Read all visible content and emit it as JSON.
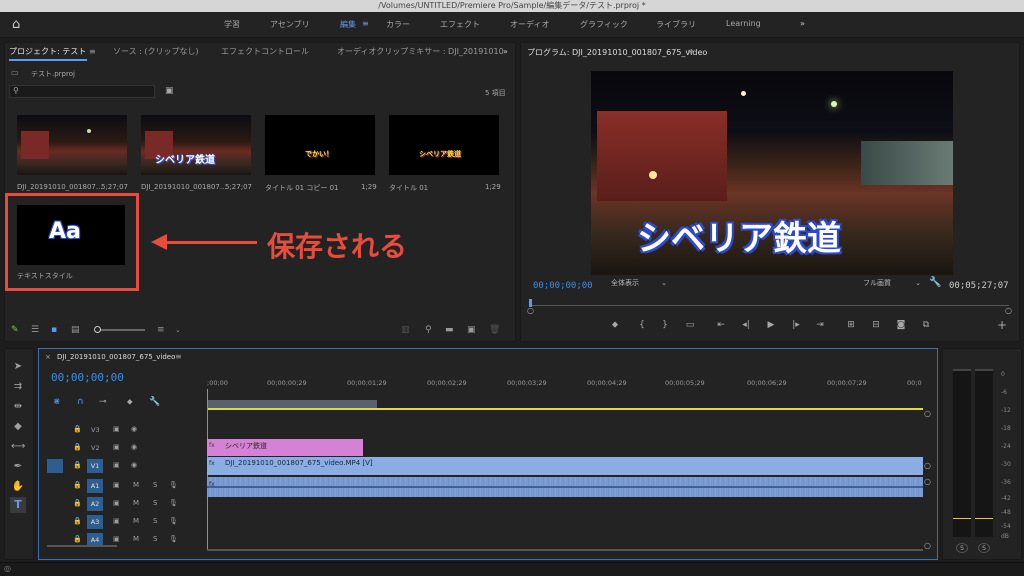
{
  "window": {
    "title": "/Volumes/UNTITLED/Premiere Pro/Sample/編集データ/テスト.prproj *"
  },
  "workspaces": [
    "学習",
    "アセンブリ",
    "編集",
    "カラー",
    "エフェクト",
    "オーディオ",
    "グラフィック",
    "ライブラリ",
    "Learning"
  ],
  "workspace_more": "»",
  "project_panel": {
    "tabs": [
      "プロジェクト: テスト",
      "ソース : (クリップなし)",
      "エフェクトコントロール",
      "オーディオクリップミキサー : DJI_20191010"
    ],
    "more": "»",
    "file": "テスト.prproj",
    "item_count": "5 項目",
    "items": [
      {
        "name": "DJI_20191010_001807...",
        "duration": "5;27;07",
        "overlay": ""
      },
      {
        "name": "DJI_20191010_001807...",
        "duration": "5;27;07",
        "overlay": "シベリア鉄道"
      },
      {
        "name": "タイトル 01 コピー 01",
        "duration": "1;29",
        "overlay": "でかい！"
      },
      {
        "name": "タイトル 01",
        "duration": "1;29",
        "overlay": "シベリア鉄道"
      },
      {
        "name": "テキストスタイル",
        "duration": "",
        "overlay": "Aa"
      }
    ]
  },
  "annotation": {
    "text": "保存される",
    "color": "#e74c3c"
  },
  "program_monitor": {
    "title": "プログラム: DJI_20191010_001807_675_video",
    "overlay_text": "シベリア鉄道",
    "timecode": "00;00;00;00",
    "fit": "全体表示",
    "quality": "フル画質",
    "duration": "00;05;27;07"
  },
  "timeline": {
    "sequence": "DJI_20191010_001807_675_video",
    "timecode": "00;00;00;00",
    "ruler": [
      ";00;00",
      "00;00;00;29",
      "00;00;01;29",
      "00;00;02;29",
      "00;00;03;29",
      "00;00;04;29",
      "00;00;05;29",
      "00;00;06;29",
      "00;00;07;29",
      "00;0"
    ],
    "video_tracks": [
      "V3",
      "V2",
      "V1"
    ],
    "audio_tracks": [
      "A1",
      "A2",
      "A3",
      "A4"
    ],
    "clip_title": "シベリア鉄道",
    "clip_video": "DJI_20191010_001807_675_video.MP4 [V]",
    "mute": "M",
    "solo": "S"
  },
  "meter": {
    "scale": [
      "0",
      "-6",
      "-12",
      "-18",
      "-24",
      "-30",
      "-36",
      "-42",
      "-48",
      "-54",
      "dB"
    ],
    "solo": [
      "S",
      "S"
    ]
  },
  "colors": {
    "accent": "#5d9bf2",
    "clip_pink": "#d581d5",
    "clip_blue": "#8aaee3",
    "timecode": "#3a8ee6"
  }
}
